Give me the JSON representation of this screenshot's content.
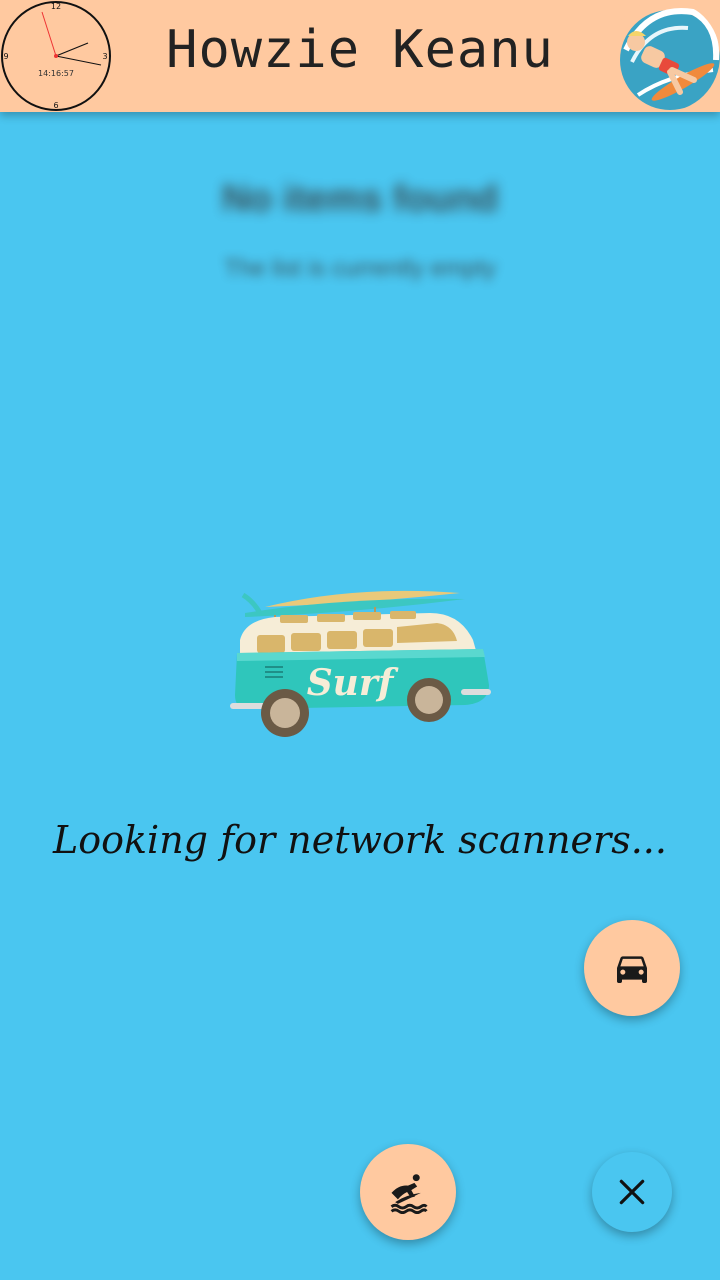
{
  "header": {
    "title": "Howzie Keanu",
    "clock": {
      "time_text": "14:16:57",
      "marks": {
        "top": "12",
        "right": "3",
        "bottom": "6",
        "left": "9"
      }
    },
    "avatar_icon": "surfer-avatar-icon"
  },
  "empty_state": {
    "title": "No items found",
    "subtitle": "The list is currently empty"
  },
  "illustration": {
    "icon": "surf-van-icon",
    "van_text": "Surf"
  },
  "status_text": "Looking for network scanners...",
  "fabs": {
    "car_icon": "car-icon",
    "surf_icon": "surfing-icon",
    "close_icon": "close-icon"
  },
  "colors": {
    "background": "#4ac6f0",
    "header": "#ffc9a0",
    "fab": "#ffc9a0"
  }
}
